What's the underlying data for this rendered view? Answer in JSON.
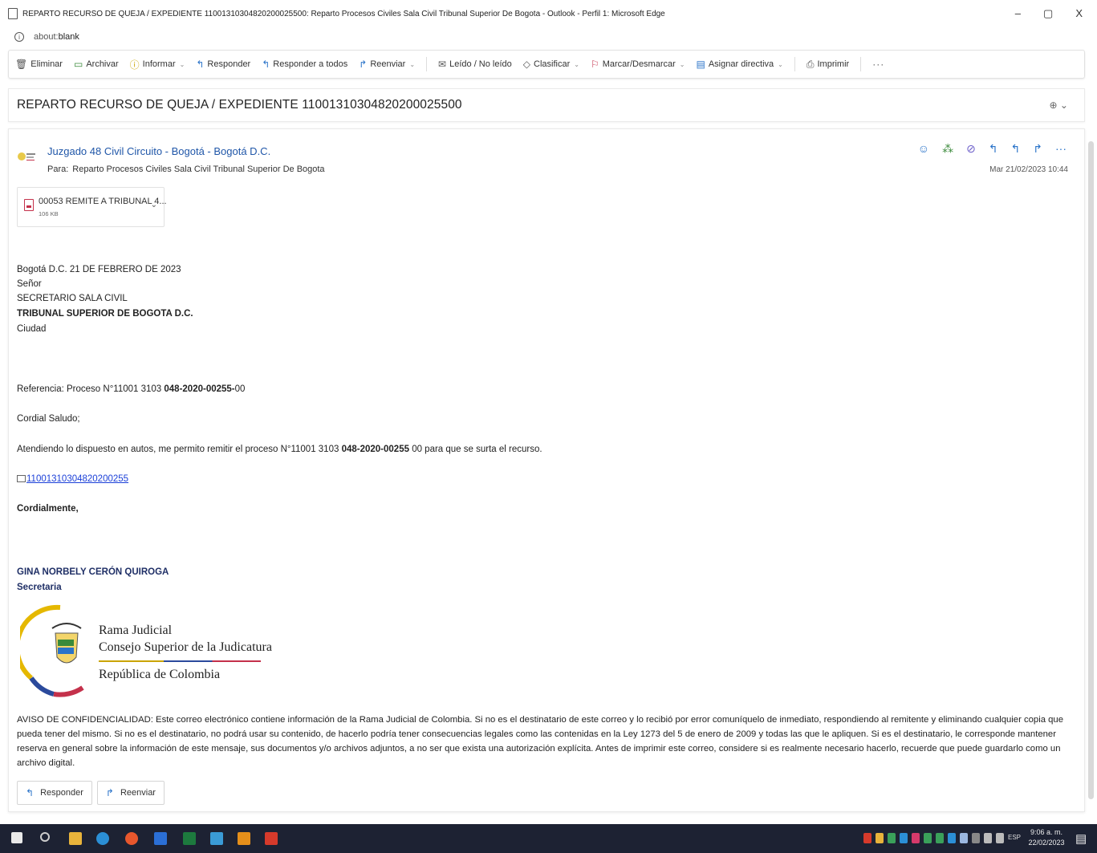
{
  "window": {
    "title": "REPARTO RECURSO DE QUEJA / EXPEDIENTE 11001310304820200025500: Reparto Procesos Civiles Sala Civil Tribunal Superior De Bogota - Outlook - Perfil 1: Microsoft Edge",
    "minimize": "–",
    "maximize": "▢",
    "close": "X"
  },
  "address": {
    "prefix": "about:",
    "host": "blank"
  },
  "toolbar": {
    "delete": "Eliminar",
    "archive": "Archivar",
    "report": "Informar",
    "reply": "Responder",
    "reply_all": "Responder a todos",
    "forward": "Reenviar",
    "read_unread": "Leído / No leído",
    "categorize": "Clasificar",
    "flag": "Marcar/Desmarcar",
    "assign_policy": "Asignar directiva",
    "print": "Imprimir",
    "more": "···"
  },
  "subject": "REPARTO RECURSO DE QUEJA / EXPEDIENTE 11001310304820200025500",
  "message": {
    "sender": "Juzgado 48 Civil Circuito - Bogotá - Bogotá D.C.",
    "to_label": "Para:",
    "to": "Reparto Procesos Civiles Sala Civil Tribunal Superior De Bogota",
    "date": "Mar 21/02/2023 10:44",
    "attachment": {
      "name": "00053 REMITE A TRIBUNAL 4...",
      "size": "106 KB"
    },
    "body": {
      "place_date": "Bogotá D.C. 21 DE FEBRERO DE 2023",
      "salutation1": "Señor",
      "recipient_role": "SECRETARIO SALA CIVIL",
      "recipient_org": "TRIBUNAL SUPERIOR DE BOGOTA D.C.",
      "city": "Ciudad",
      "ref_prefix": "Referencia: Proceso N°11001 3103 ",
      "ref_bold": "048-2020-00255-",
      "ref_suffix": "00",
      "greeting": "Cordial Saludo;",
      "para_prefix": "Atendiendo lo dispuesto en autos, me permito remitir el proceso N°11001 3103 ",
      "para_bold": "048-2020-00255",
      "para_suffix": " 00 para que se surta el recurso.",
      "link": "11001310304820200255",
      "closing": "Cordialmente,",
      "signer": "GINA NORBELY CERÓN QUIROGA",
      "signer_title": "Secretaria"
    },
    "logo": {
      "line1": "Rama Judicial",
      "line2": "Consejo Superior de la Judicatura",
      "line3": "República de Colombia"
    },
    "disclaimer": "AVISO DE CONFIDENCIALIDAD: Este correo electrónico contiene información de la Rama Judicial de Colombia. Si no es el destinatario de este correo y lo recibió por error comuníquelo de inmediato, respondiendo al remitente y eliminando cualquier copia que pueda tener del mismo. Si no es el destinatario, no podrá usar su contenido, de hacerlo podría tener consecuencias legales como las contenidas en la Ley 1273 del 5 de enero de 2009 y todas las que le apliquen. Si es el destinatario, le corresponde mantener reserva en general sobre la información de este mensaje, sus documentos y/o archivos adjuntos, a no ser que exista una autorización explícita. Antes de imprimir este correo, considere si es realmente necesario hacerlo, recuerde que puede guardarlo como un archivo digital.",
    "reply_button": "Responder",
    "forward_button": "Reenviar"
  },
  "taskbar": {
    "lang": "ESP",
    "time": "9:06 a. m.",
    "date": "22/02/2023"
  }
}
